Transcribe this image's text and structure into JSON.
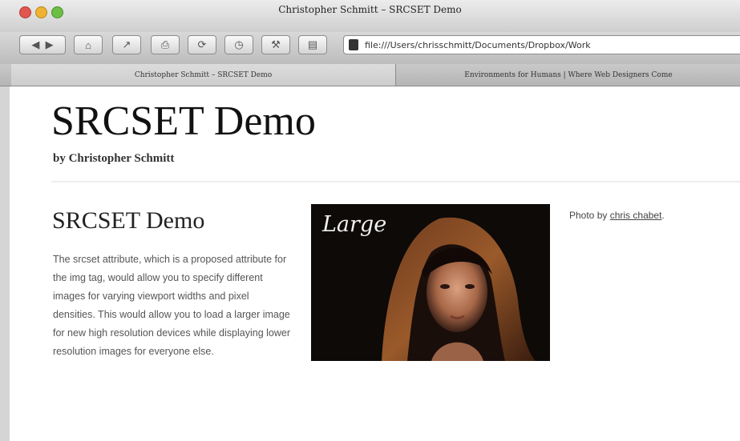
{
  "window": {
    "title": "Christopher Schmitt – SRCSET Demo"
  },
  "toolbar": {
    "address": "file:///Users/chrisschmitt/Documents/Dropbox/Work"
  },
  "tabs": [
    {
      "label": "Christopher Schmitt – SRCSET Demo"
    },
    {
      "label": "Environments for Humans | Where Web Designers Come"
    }
  ],
  "page": {
    "heading": "SRCSET Demo",
    "byline": "by Christopher Schmitt",
    "section_heading": "SRCSET Demo",
    "body": "The srcset attribute, which is a proposed attribute for the img tag, would allow you to specify different images for varying viewport widths and pixel densities. This would allow you to load a larger image for new high resolution devices while displaying lower resolution images for everyone else.",
    "photo_label": "Large",
    "credit_prefix": "Photo by",
    "credit_link": "chris chabet"
  },
  "colors": {
    "close": "#e2564d",
    "minimize": "#f0b232",
    "zoom": "#6cbf44"
  }
}
